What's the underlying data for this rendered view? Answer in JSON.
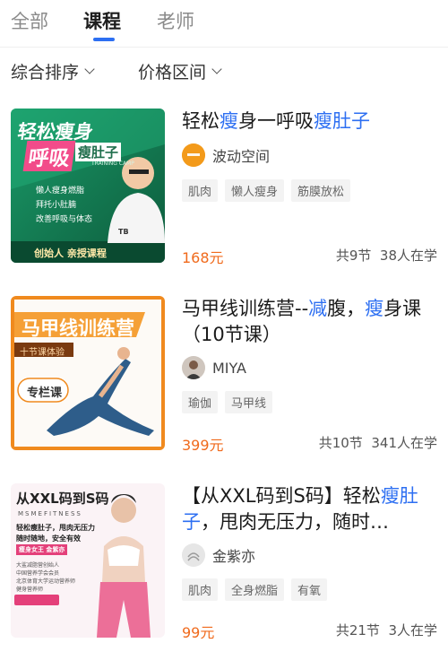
{
  "tabs": [
    {
      "label": "全部"
    },
    {
      "label": "课程"
    },
    {
      "label": "老师"
    }
  ],
  "filters": {
    "sort_label": "综合排序",
    "price_label": "价格区间"
  },
  "courses": [
    {
      "title_parts": [
        "轻松",
        "瘦",
        "身一呼吸",
        "瘦肚子"
      ],
      "teacher": "波动空间",
      "tags": [
        "肌肉",
        "懒人瘦身",
        "筋膜放松"
      ],
      "price": "168元",
      "lessons": "共9节",
      "students": "38人在学",
      "thumb": {
        "line1": "轻松瘦身",
        "line2": "呼吸",
        "line3": "瘦肚子",
        "sub": "TRAINING CAMP",
        "bullets": [
          "懒人瘦身燃脂",
          "拜托小肚腩",
          "改善呼吸与体态"
        ],
        "footer": "创始人 亲授课程",
        "brand_color": "#1f8a5c"
      }
    },
    {
      "title_parts": [
        "马甲线训练营--",
        "减",
        "腹，",
        "瘦",
        "身课（10节课）"
      ],
      "teacher": "MIYA",
      "tags": [
        "瑜伽",
        "马甲线"
      ],
      "price": "399元",
      "lessons": "共10节",
      "students": "341人在学",
      "thumb": {
        "line1": "马甲线训练营",
        "sub": "十节课体验",
        "badge": "专栏课",
        "brand_color": "#f08a1e"
      }
    },
    {
      "title_parts": [
        "【从XXL码到S码】轻松",
        "瘦",
        "肚子",
        "，甩肉无压力，随时…"
      ],
      "teacher": "金紫亦",
      "tags": [
        "肌肉",
        "全身燃脂",
        "有氧"
      ],
      "price": "99元",
      "lessons": "共21节",
      "students": "3人在学",
      "thumb": {
        "line1": "从XXL码到S码",
        "brand": "MSMEFITNESS",
        "line2": "轻松瘦肚子，甩肉无压力",
        "line3": "随时随地，安全有效",
        "badge": "瘦身女王 金紫亦",
        "notes": [
          "大鲨减脂营创始人",
          "中国营养学会会员",
          "北京体育大学运动营养师",
          "健身营养师"
        ],
        "brand_color": "#e4407a"
      }
    }
  ]
}
